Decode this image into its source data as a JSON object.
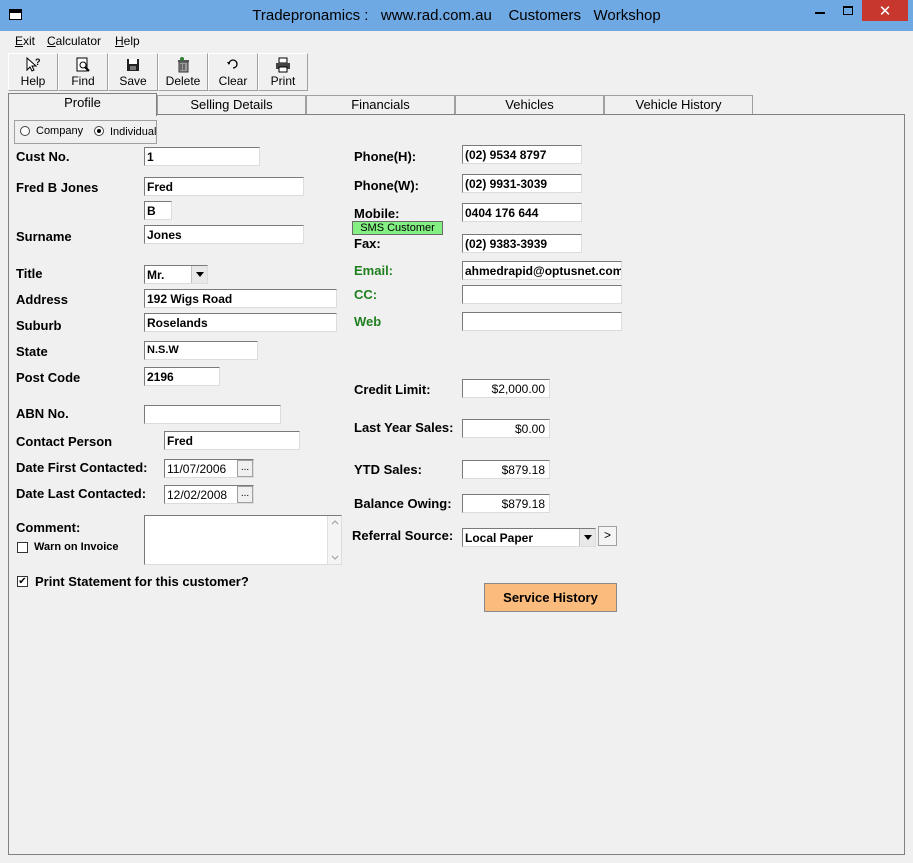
{
  "window": {
    "title": "Tradepronamics :   www.rad.com.au    Customers   Workshop",
    "close_glyph": "✕"
  },
  "menu": [
    {
      "label": "Exit",
      "key": "E"
    },
    {
      "label": "Calculator",
      "key": "C"
    },
    {
      "label": "Help",
      "key": "H"
    }
  ],
  "toolbar": {
    "help": "Help",
    "find": "Find",
    "save": "Save",
    "delete": "Delete",
    "clear": "Clear",
    "print": "Print"
  },
  "tabs": [
    "Profile",
    "Selling Details",
    "Financials",
    "Vehicles",
    "Vehicle History"
  ],
  "type_choice": {
    "company": "Company",
    "individual": "Individual",
    "selected": "Individual"
  },
  "labels": {
    "cust_no": "Cust No.",
    "full_name": "Fred B Jones",
    "surname": "Surname",
    "title": "Title",
    "address": "Address",
    "suburb": "Suburb",
    "state": "State",
    "post_code": "Post Code",
    "abn": "ABN No.",
    "contact_person": "Contact Person",
    "date_first": "Date First Contacted:",
    "date_last": "Date Last Contacted:",
    "comment": "Comment:",
    "warn_invoice": "Warn on Invoice",
    "print_statement": "Print Statement for this customer?",
    "phone_h": "Phone(H):",
    "phone_w": "Phone(W):",
    "mobile": "Mobile:",
    "fax": "Fax:",
    "email": "Email:",
    "cc": "CC:",
    "web": "Web",
    "credit_limit": "Credit Limit:",
    "last_year_sales": "Last Year Sales:",
    "ytd_sales": "YTD Sales:",
    "balance_owing": "Balance Owing:",
    "referral_source": "Referral Source:"
  },
  "values": {
    "cust_no": "1",
    "first_name": "Fred",
    "middle_initial": "B",
    "surname": "Jones",
    "title": "Mr.",
    "address": "192 Wigs Road",
    "suburb": "Roselands",
    "state": "N.S.W",
    "post_code": "2196",
    "abn": "",
    "contact_person": "Fred",
    "date_first": "11/07/2006",
    "date_last": "12/02/2008",
    "comment": "",
    "warn_invoice": false,
    "print_statement": true,
    "phone_h": "(02) 9534 8797",
    "phone_w": "(02) 9931-3039",
    "mobile": "0404 176 644",
    "fax": "(02) 9383-3939",
    "email": "ahmedrapid@optusnet.com",
    "cc": "",
    "web": "",
    "credit_limit": "$2,000.00",
    "last_year_sales": "$0.00",
    "ytd_sales": "$879.18",
    "balance_owing": "$879.18",
    "referral_source": "Local Paper"
  },
  "buttons": {
    "sms_customer": "SMS Customer",
    "service_history": "Service History",
    "ellipsis": "...",
    "referral_next": ">"
  },
  "colors": {
    "titlebar": "#6fa9e3",
    "close": "#c7372e",
    "sms": "#84f084",
    "service_history": "#fbbb7c",
    "green_label": "#1f7f1f"
  }
}
